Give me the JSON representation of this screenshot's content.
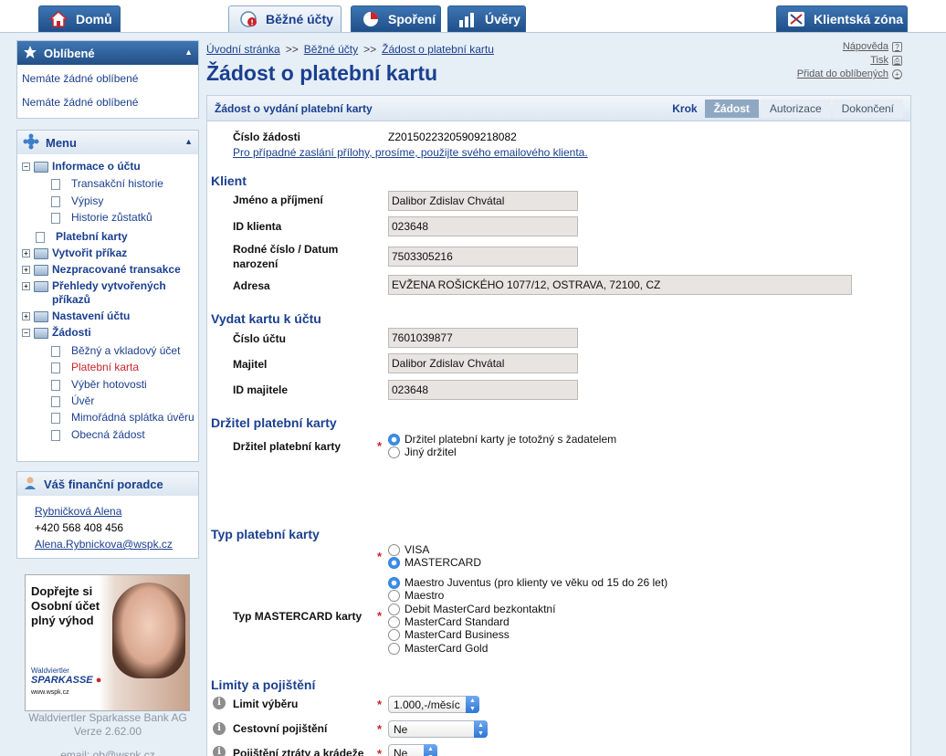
{
  "nav": {
    "tabs": [
      {
        "label": "Domů",
        "icon": "house-icon"
      },
      {
        "label": "Běžné účty",
        "icon": "accounts-icon"
      },
      {
        "label": "Spoření",
        "icon": "pie-chart-icon"
      },
      {
        "label": "Úvěry",
        "icon": "bar-chart-icon"
      }
    ],
    "client_zone": "Klientská zóna"
  },
  "favorites": {
    "title": "Oblíbené",
    "items": [
      "Nemáte žádné oblíbené",
      "Nemáte žádné oblíbené"
    ]
  },
  "menu": {
    "title": "Menu",
    "info": "Informace o účtu",
    "transakcni": "Transakční historie",
    "vypisy": "Výpisy",
    "historie": "Historie zůstatků",
    "platebni_karty": "Platební karty",
    "vytvorit": "Vytvořit příkaz",
    "nezpracovane": "Nezpracované transakce",
    "prehledy": "Přehledy vytvořených příkazů",
    "nastaveni": "Nastavení účtu",
    "zadosti": "Žádosti",
    "bezny": "Běžný a vkladový účet",
    "platebni_karta": "Platební karta",
    "vyber": "Výběr hotovosti",
    "uver": "Úvěr",
    "mimoradna": "Mimořádná splátka úvěru",
    "obecna": "Obecná žádost"
  },
  "advisor": {
    "title": "Váš finanční poradce",
    "name": "Rybničková Alena",
    "phone": "+420 568 408 456",
    "email": "Alena.Rybnickova@wspk.cz"
  },
  "ad": {
    "headline": "Dopřejte si Osobní účet plný výhod",
    "brand_small": "Waldviertler",
    "brand": "SPARKASSE",
    "url": "www.wspk.cz"
  },
  "footer": {
    "bank": "Waldviertler Sparkasse Bank AG",
    "version": "Verze 2.62.00",
    "email": "email: ob@wspk.cz"
  },
  "breadcrumb": [
    "Úvodní stránka",
    "Běžné účty",
    "Žádost o platební kartu"
  ],
  "utils": {
    "help": "Nápověda",
    "print": "Tisk",
    "add_fav": "Přidat do oblíbených"
  },
  "page_title": "Žádost o platební kartu",
  "panel": {
    "title": "Žádost o vydání platební karty",
    "steps_label": "Krok",
    "steps": [
      "Žádost",
      "Autorizace",
      "Dokončení"
    ]
  },
  "form": {
    "request_no_label": "Číslo žádosti",
    "request_no": "Z20150223205909218082",
    "attach_note": "Pro případné zaslání přílohy, prosíme, použijte svého emailového klienta.",
    "client_section": "Klient",
    "name_label": "Jméno a příjmení",
    "name": "Dalibor Zdislav Chvátal",
    "client_id_label": "ID klienta",
    "client_id": "023648",
    "birth_label": "Rodné číslo / Datum narození",
    "birth": "7503305216",
    "address_label": "Adresa",
    "address": "EVŽENA ROŠICKÉHO 1077/12, OSTRAVA, 72100, CZ",
    "account_section": "Vydat kartu k účtu",
    "account_label": "Číslo účtu",
    "account": "7601039877",
    "owner_label": "Majitel",
    "owner": "Dalibor Zdislav Chvátal",
    "owner_id_label": "ID majitele",
    "owner_id": "023648",
    "holder_section": "Držitel platební karty",
    "holder_label": "Držitel platební karty",
    "holder_opt1": "Držitel platební karty je totožný s žadatelem",
    "holder_opt2": "Jiný držitel",
    "type_section": "Typ platební karty",
    "type_visa": "VISA",
    "type_mc": "MASTERCARD",
    "mc_type_label": "Typ MASTERCARD karty",
    "mc_opts": [
      "Maestro Juventus (pro klienty ve věku od 15 do 26 let)",
      "Maestro",
      "Debit MasterCard bezkontaktní",
      "MasterCard Standard",
      "MasterCard Business",
      "MasterCard Gold"
    ],
    "limits_section": "Limity a pojištění",
    "limit_label": "Limit výběru",
    "limit_value": "1.000,-/měsíc",
    "travel_label": "Cestovní pojištění",
    "travel_value": "Ne",
    "loss_label": "Pojištění ztráty a krádeže",
    "loss_value": "Ne",
    "required_mark": "*"
  }
}
